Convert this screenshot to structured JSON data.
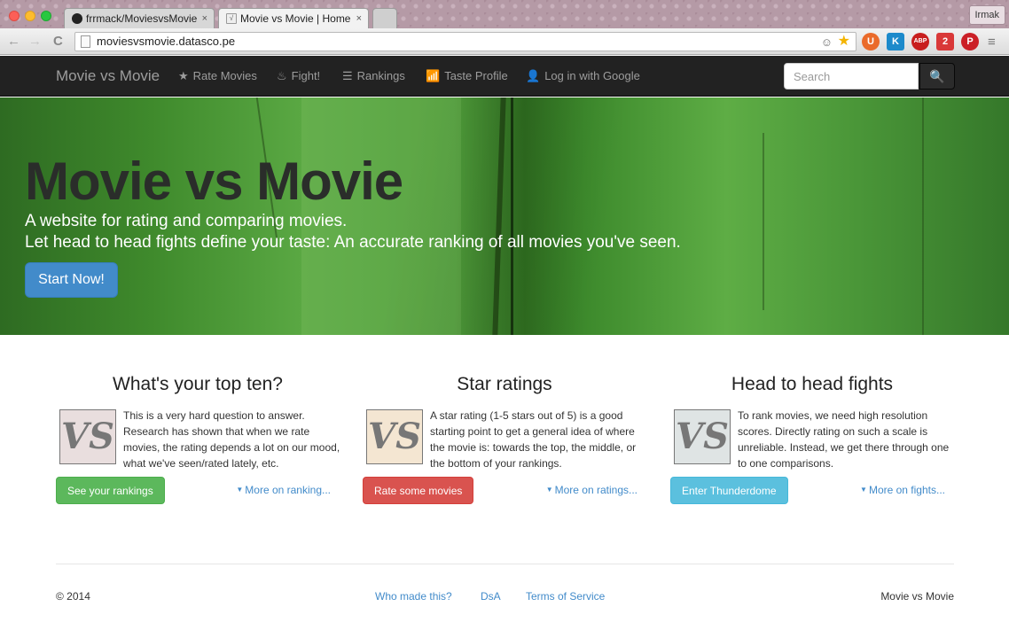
{
  "browser": {
    "tabs": [
      {
        "title": "frrmack/MoviesvsMovie",
        "active": false
      },
      {
        "title": "Movie vs Movie | Home",
        "active": true
      }
    ],
    "tab_close": "×",
    "user": "Irmak",
    "url": "moviesvsmovie.datasco.pe",
    "nav": {
      "back": "←",
      "forward": "→",
      "reload": "C"
    },
    "extensions": [
      {
        "name": "ext-shield-icon",
        "label": "U"
      },
      {
        "name": "ext-k-icon",
        "label": "K"
      },
      {
        "name": "adblock-icon",
        "label": "ABP"
      },
      {
        "name": "ext-puzzle-icon",
        "label": "2"
      },
      {
        "name": "pinterest-icon",
        "label": "P"
      }
    ],
    "menu_glyph": "≡"
  },
  "navbar": {
    "brand": "Movie vs Movie",
    "links": [
      {
        "glyph": "★",
        "label": "Rate Movies"
      },
      {
        "glyph": "♨",
        "label": "Fight!"
      },
      {
        "glyph": "☰",
        "label": "Rankings"
      },
      {
        "glyph": "📶",
        "label": "Taste Profile"
      },
      {
        "glyph": "👤",
        "label": "Log in with Google"
      }
    ],
    "search_placeholder": "Search",
    "search_glyph": "🔍"
  },
  "hero": {
    "title": "Movie vs Movie",
    "line1": "A website for rating and comparing movies.",
    "line2": "Let head to head fights define your taste: An accurate ranking of all movies you've seen.",
    "cta": "Start Now!"
  },
  "features": [
    {
      "title": "What's your top ten?",
      "logo": "VS",
      "text": "This is a very hard question to answer. Research has shown that when we rate movies, the rating depends a lot on our mood, what we've seen/rated lately, etc.",
      "button": "See your rankings",
      "more": "More on ranking..."
    },
    {
      "title": "Star ratings",
      "logo": "VS",
      "text": "A star rating (1-5 stars out of 5) is a good starting point to get a general idea of where the movie is: towards the top, the middle, or the bottom of your rankings.",
      "button": "Rate some movies",
      "more": "More on ratings..."
    },
    {
      "title": "Head to head fights",
      "logo": "VS",
      "text": "To rank movies, we need high resolution scores. Directly rating on such a scale is unreliable. Instead, we get there through one to one comparisons.",
      "button": "Enter Thunderdome",
      "more": "More on fights..."
    }
  ],
  "footer": {
    "copyright": "© 2014",
    "links": [
      "Who made this?",
      "DsA",
      "Terms of Service"
    ],
    "brand": "Movie vs Movie"
  },
  "colors": {
    "navbar": "#222222",
    "primary": "#428bca",
    "success": "#5cb85c",
    "danger": "#d9534f",
    "info": "#5bc0de"
  }
}
